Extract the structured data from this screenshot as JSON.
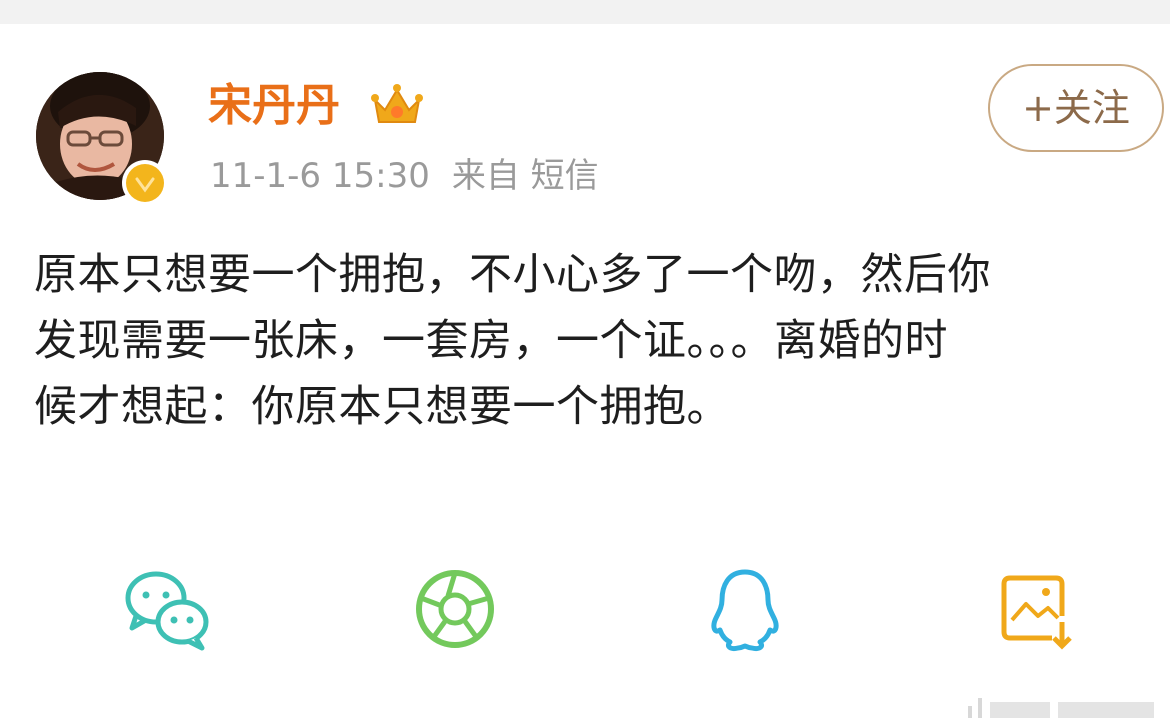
{
  "user": {
    "name": "宋丹丹",
    "timestamp": "11-1-6 15:30",
    "source": "来自 短信",
    "follow_label": "+关注"
  },
  "post": {
    "text": "原本只想要一个拥抱，不小心多了一个吻，然后你\n发现需要一张床，一套房，一个证。。。离婚的时\n候才想起：你原本只想要一个拥抱。"
  },
  "share": {
    "icons": [
      "wechat-icon",
      "moments-icon",
      "qq-icon",
      "save-image-icon"
    ]
  },
  "colors": {
    "name": "#e96f18",
    "meta": "#9a9a9a",
    "follow_border": "#c9a983",
    "follow_text": "#8c6a4a",
    "wechat": "#3ec0b4",
    "moments": "#73c95c",
    "qq": "#31b0e0",
    "save_image": "#f0a81a",
    "verified_badge": "#f3b51c"
  }
}
